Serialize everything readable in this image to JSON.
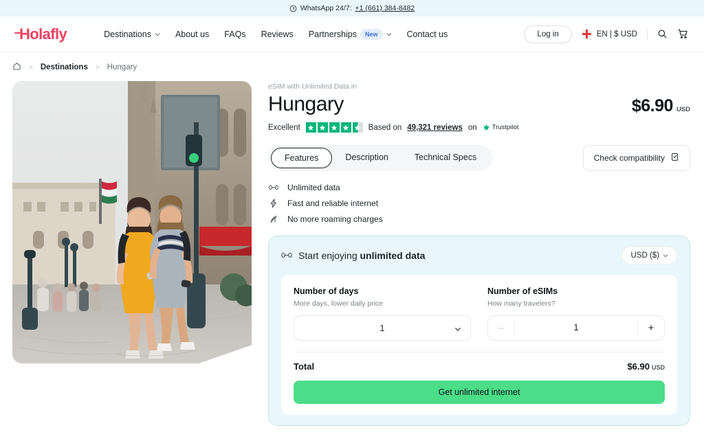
{
  "promo": {
    "icon": "whatsapp-icon",
    "text": "WhatsApp 24/7:",
    "phone": "+1 (661) 384-8482"
  },
  "header": {
    "logo": "Holafly",
    "nav": [
      {
        "label": "Destinations",
        "has_chevron": true
      },
      {
        "label": "About us",
        "has_chevron": false
      },
      {
        "label": "FAQs",
        "has_chevron": false
      },
      {
        "label": "Reviews",
        "has_chevron": false
      },
      {
        "label": "Partnerships",
        "badge": "New",
        "has_chevron": true
      },
      {
        "label": "Contact us",
        "has_chevron": false
      }
    ],
    "login_label": "Log in",
    "locale_label": "EN | $ USD",
    "search_icon": "search-icon",
    "cart_icon": "cart-icon"
  },
  "breadcrumb": {
    "home_icon": "home-icon",
    "items": [
      "Destinations",
      "Hungary"
    ]
  },
  "product": {
    "eyebrow": "eSIM with Unlimited Data in",
    "title": "Hungary",
    "price": "$6.90",
    "price_currency": "USD",
    "trust": {
      "rating_word": "Excellent",
      "stars_filled": 4,
      "stars_half": 1,
      "based_on": "Based on",
      "reviews": "49,321 reviews",
      "on": "on",
      "platform": "Trustpilot"
    },
    "tabs": [
      {
        "label": "Features",
        "active": true
      },
      {
        "label": "Description",
        "active": false
      },
      {
        "label": "Technical Specs",
        "active": false
      }
    ],
    "compatibility_label": "Check compatibility",
    "features": [
      {
        "icon": "infinity-icon",
        "label": "Unlimited data"
      },
      {
        "icon": "bolt-icon",
        "label": "Fast and reliable internet"
      },
      {
        "icon": "no-roaming-icon",
        "label": "No more roaming charges"
      }
    ]
  },
  "buycard": {
    "header_icon": "infinity-icon",
    "header_text_plain": "Start enjoying ",
    "header_text_bold": "unlimited data",
    "currency_selected": "USD ($)",
    "days": {
      "label": "Number of days",
      "sub": "More days, lower daily price",
      "value": "1"
    },
    "esims": {
      "label": "Number of eSIMs",
      "sub": "How many travelers?",
      "value": "1",
      "minus": "–",
      "plus": "+"
    },
    "total_label": "Total",
    "total_value": "$6.90",
    "total_currency": "USD",
    "cta_label": "Get unlimited internet"
  },
  "colors": {
    "brand": "#ef4060",
    "cta_green": "#4cdd88",
    "trustpilot_green": "#00b67a",
    "promo_bg": "#e9f6fb",
    "card_border": "#bfe6df"
  }
}
